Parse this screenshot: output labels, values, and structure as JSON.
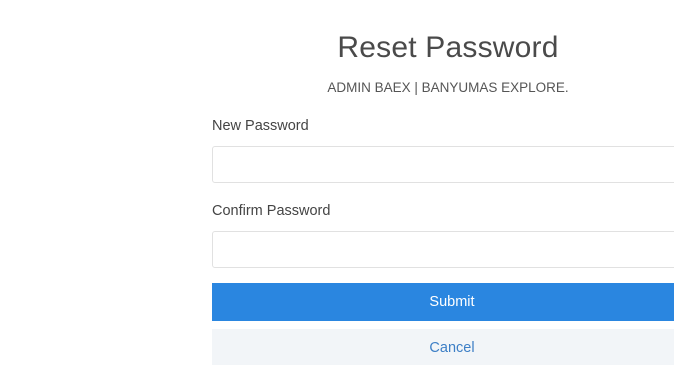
{
  "header": {
    "title": "Reset Password",
    "subtitle": "ADMIN BAEX | BANYUMAS EXPLORE."
  },
  "form": {
    "new_password_label": "New Password",
    "new_password_value": "",
    "confirm_password_label": "Confirm Password",
    "confirm_password_value": "",
    "submit_label": "Submit",
    "cancel_label": "Cancel"
  },
  "colors": {
    "submit_bg": "#2a86e0",
    "cancel_bg": "#f2f5f8",
    "cancel_text": "#3d7fc6"
  }
}
